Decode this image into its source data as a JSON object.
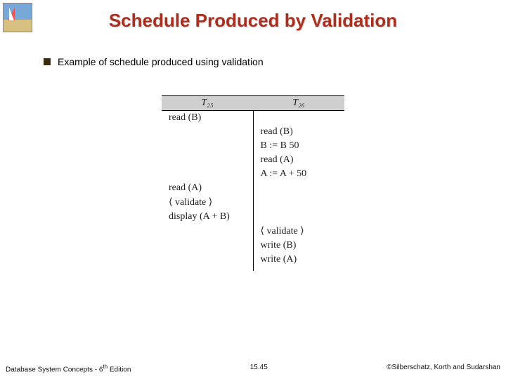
{
  "title": "Schedule Produced by Validation",
  "bullet": "Example of schedule produced using validation",
  "table": {
    "headers": {
      "t25": "T₂₅",
      "t26": "T₂₆"
    },
    "rows": [
      {
        "left": "read (B)",
        "right": ""
      },
      {
        "left": "",
        "right": "read (B)"
      },
      {
        "left": "",
        "right": "B := B   50"
      },
      {
        "left": "",
        "right": "read (A)"
      },
      {
        "left": "",
        "right": "A := A + 50"
      },
      {
        "left": "read (A)",
        "right": ""
      },
      {
        "left": "⟨ validate ⟩",
        "right": ""
      },
      {
        "left": "display (A + B)",
        "right": ""
      },
      {
        "left": "",
        "right": "⟨ validate ⟩"
      },
      {
        "left": "",
        "right": "write (B)"
      },
      {
        "left": "",
        "right": "write (A)"
      }
    ]
  },
  "footer": {
    "left_a": "Database System Concepts - 6",
    "left_sup": "th",
    "left_b": " Edition",
    "center": "15.45",
    "right": "©Silberschatz, Korth and Sudarshan"
  }
}
